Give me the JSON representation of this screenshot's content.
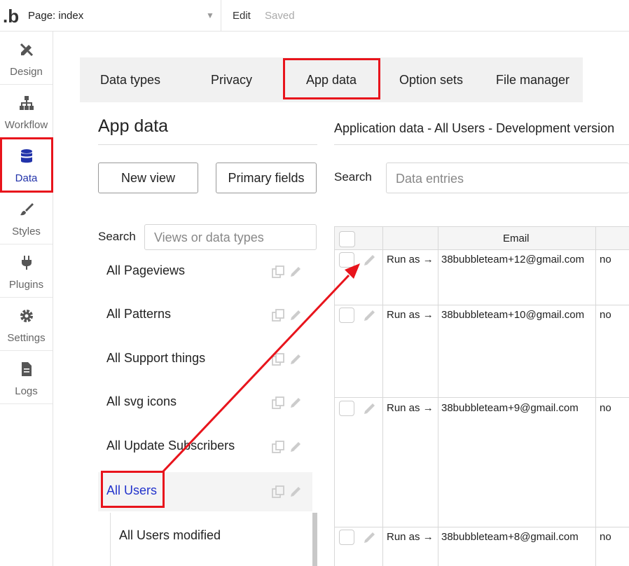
{
  "topbar": {
    "logo": ".b",
    "page_label": "Page: index",
    "edit": "Edit",
    "saved": "Saved"
  },
  "sidebar": {
    "items": [
      {
        "label": "Design",
        "icon": "design-icon"
      },
      {
        "label": "Workflow",
        "icon": "workflow-icon"
      },
      {
        "label": "Data",
        "icon": "database-icon",
        "active": true
      },
      {
        "label": "Styles",
        "icon": "brush-icon"
      },
      {
        "label": "Plugins",
        "icon": "plug-icon"
      },
      {
        "label": "Settings",
        "icon": "gear-icon"
      },
      {
        "label": "Logs",
        "icon": "document-icon"
      }
    ]
  },
  "tabs": [
    "Data types",
    "Privacy",
    "App data",
    "Option sets",
    "File manager"
  ],
  "left": {
    "title": "App data",
    "new_view": "New view",
    "primary_fields": "Primary fields",
    "search_label": "Search",
    "search_placeholder": "Views or data types",
    "views": [
      "All Pageviews",
      "All Patterns",
      "All Support things",
      "All svg icons",
      "All Update Subscribers",
      "All Users"
    ],
    "sub_view": "All Users modified"
  },
  "right": {
    "title": "Application data - All Users - Development version",
    "search_label": "Search",
    "search_placeholder": "Data entries",
    "email_header": "Email",
    "rows": [
      {
        "action": "Run as →",
        "email": "38bubbleteam+12@gmail.com",
        "value": "no"
      },
      {
        "action": "Run as →",
        "email": "38bubbleteam+10@gmail.com",
        "value": "no"
      },
      {
        "action": "Run as →",
        "email": "38bubbleteam+9@gmail.com",
        "value": "no"
      },
      {
        "action": "Run as →",
        "email": "38bubbleteam+8@gmail.com",
        "value": "no"
      }
    ]
  },
  "colors": {
    "accent": "#2233cc",
    "annotation": "#e8141c"
  }
}
